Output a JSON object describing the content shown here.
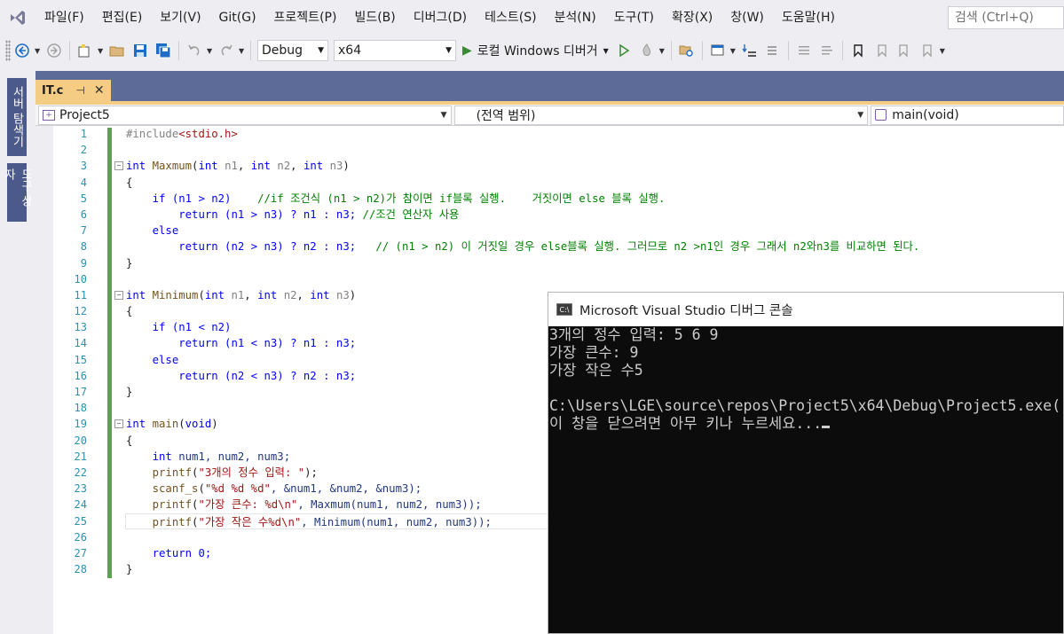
{
  "menubar": {
    "logo": "visual-studio-logo",
    "items": [
      "파일(F)",
      "편집(E)",
      "보기(V)",
      "Git(G)",
      "프로젝트(P)",
      "빌드(B)",
      "디버그(D)",
      "테스트(S)",
      "분석(N)",
      "도구(T)",
      "확장(X)",
      "창(W)",
      "도움말(H)"
    ],
    "search_placeholder": "검색 (Ctrl+Q)"
  },
  "toolbar": {
    "configuration": "Debug",
    "platform": "x64",
    "run_label": "로컬 Windows 디버거"
  },
  "left_dock": {
    "tabs": [
      "서버 탐색기",
      "도구 상자"
    ]
  },
  "document": {
    "tab_title": "IT.c",
    "nav": {
      "project": "Project5",
      "scope": "(전역 범위)",
      "member": "main(void)"
    },
    "line_numbers": [
      "1",
      "2",
      "3",
      "4",
      "5",
      "6",
      "7",
      "8",
      "9",
      "10",
      "11",
      "12",
      "13",
      "14",
      "15",
      "16",
      "17",
      "18",
      "19",
      "20",
      "21",
      "22",
      "23",
      "24",
      "25",
      "26",
      "27",
      "28"
    ],
    "code": {
      "l1_pp": "#include",
      "l1_inc": "<stdio.h>",
      "l3_kw": "int",
      "l3_fn": "Maxmum",
      "l3_a": "(",
      "l3_kw2": "int",
      "l3_p1": "n1",
      "l3_b": ", ",
      "l3_kw3": "int",
      "l3_p2": "n2",
      "l3_c": ", ",
      "l3_kw4": "int",
      "l3_p3": "n3",
      "l3_d": ")",
      "l5_code": "if (n1 > n2)",
      "l5_cmt": "//if 조건식 (n1 > n2)가 참이면 if블록 실행.    거짓이면 else 블록 실행.",
      "l6_code": "return (n1 > n3) ? n1 : n3;",
      "l6_cmt": "//조건 연산자 사용",
      "l7_code": "else",
      "l8_code": "return (n2 > n3) ? n2 : n3;",
      "l8_cmt": "// (n1 > n2) 이 거짓일 경우 else블록 실행. 그러므로 n2 >n1인 경우 그래서 n2와n3를 비교하면 된다.",
      "l11_fn": "Minimum",
      "l13_code": "if (n1 < n2)",
      "l14_code": "return (n1 < n3) ? n1 : n3;",
      "l15_code": "else",
      "l16_code": "return (n2 < n3) ? n2 : n3;",
      "l19_fn": "main",
      "l19_arg": "void",
      "l21_vars": "num1, num2, num3;",
      "l22_str": "\"3개의 정수 입력: \"",
      "l23_str": "\"%d %d %d\"",
      "l23_rest": ", &num1, &num2, &num3);",
      "l24_str": "\"가장 큰수: %d\\n\"",
      "l24_rest": ", Maxmum(num1, num2, num3));",
      "l25_str": "\"가장 작은 수%d\\n\"",
      "l25_rest": ", Minimum(num1, num2, num3));",
      "l27_code": "return 0;"
    }
  },
  "console": {
    "title": "Microsoft Visual Studio 디버그 콘솔",
    "lines": [
      "3개의 정수 입력: 5 6 9",
      "가장 큰수: 9",
      "가장 작은 수5",
      "",
      "C:\\Users\\LGE\\source\\repos\\Project5\\x64\\Debug\\Project5.exe(",
      "이 창을 닫으려면 아무 키나 누르세요..."
    ]
  }
}
